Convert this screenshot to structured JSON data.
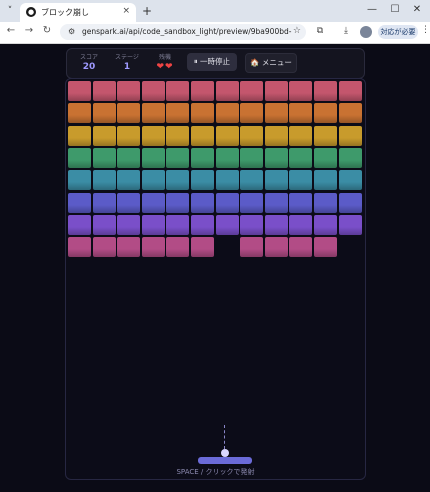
{
  "browser": {
    "tab_title": "ブロック崩し",
    "tab_icon_glyph": "●",
    "tab_close": "×",
    "tab_list_glyph": "˅",
    "new_tab": "+",
    "window": {
      "minimize": "—",
      "maximize": "☐",
      "close": "✕"
    },
    "nav": {
      "back": "←",
      "forward": "→",
      "reload": "↻"
    },
    "site_icon": "⚙",
    "url": "genspark.ai/api/code_sandbox_light/preview/9ba900bd-60df-42e...",
    "star": "☆",
    "extensions_icon": "⧉",
    "download_icon": "⤓",
    "cta_label": "対応が必要",
    "menu_dots": "⋮"
  },
  "hud": {
    "score_label": "スコア",
    "score_value": "20",
    "stage_label": "ステージ",
    "stage_value": "1",
    "lives_label": "残機",
    "lives_value": "❤❤",
    "pause_label": "⏸ 一時停止",
    "menu_label": "🏠 メニュー"
  },
  "game": {
    "rows": [
      {
        "color": "#c4566d",
        "bricks": [
          1,
          1,
          1,
          1,
          1,
          1,
          1,
          1,
          1,
          1,
          1,
          1
        ]
      },
      {
        "color": "#c97232",
        "bricks": [
          1,
          1,
          1,
          1,
          1,
          1,
          1,
          1,
          1,
          1,
          1,
          1
        ]
      },
      {
        "color": "#c89b2c",
        "bricks": [
          1,
          1,
          1,
          1,
          1,
          1,
          1,
          1,
          1,
          1,
          1,
          1
        ]
      },
      {
        "color": "#3e9a6b",
        "bricks": [
          1,
          1,
          1,
          1,
          1,
          1,
          1,
          1,
          1,
          1,
          1,
          1
        ]
      },
      {
        "color": "#3b8da5",
        "bricks": [
          1,
          1,
          1,
          1,
          1,
          1,
          1,
          1,
          1,
          1,
          1,
          1
        ]
      },
      {
        "color": "#5b5bc8",
        "bricks": [
          1,
          1,
          1,
          1,
          1,
          1,
          1,
          1,
          1,
          1,
          1,
          1
        ]
      },
      {
        "color": "#7a4fc9",
        "bricks": [
          1,
          1,
          1,
          1,
          1,
          1,
          1,
          1,
          1,
          1,
          1,
          1
        ]
      },
      {
        "color": "#b24c86",
        "bricks": [
          1,
          1,
          1,
          1,
          1,
          1,
          0,
          1,
          1,
          1,
          1,
          0
        ]
      }
    ],
    "hint": "SPACE / クリックで発射"
  }
}
